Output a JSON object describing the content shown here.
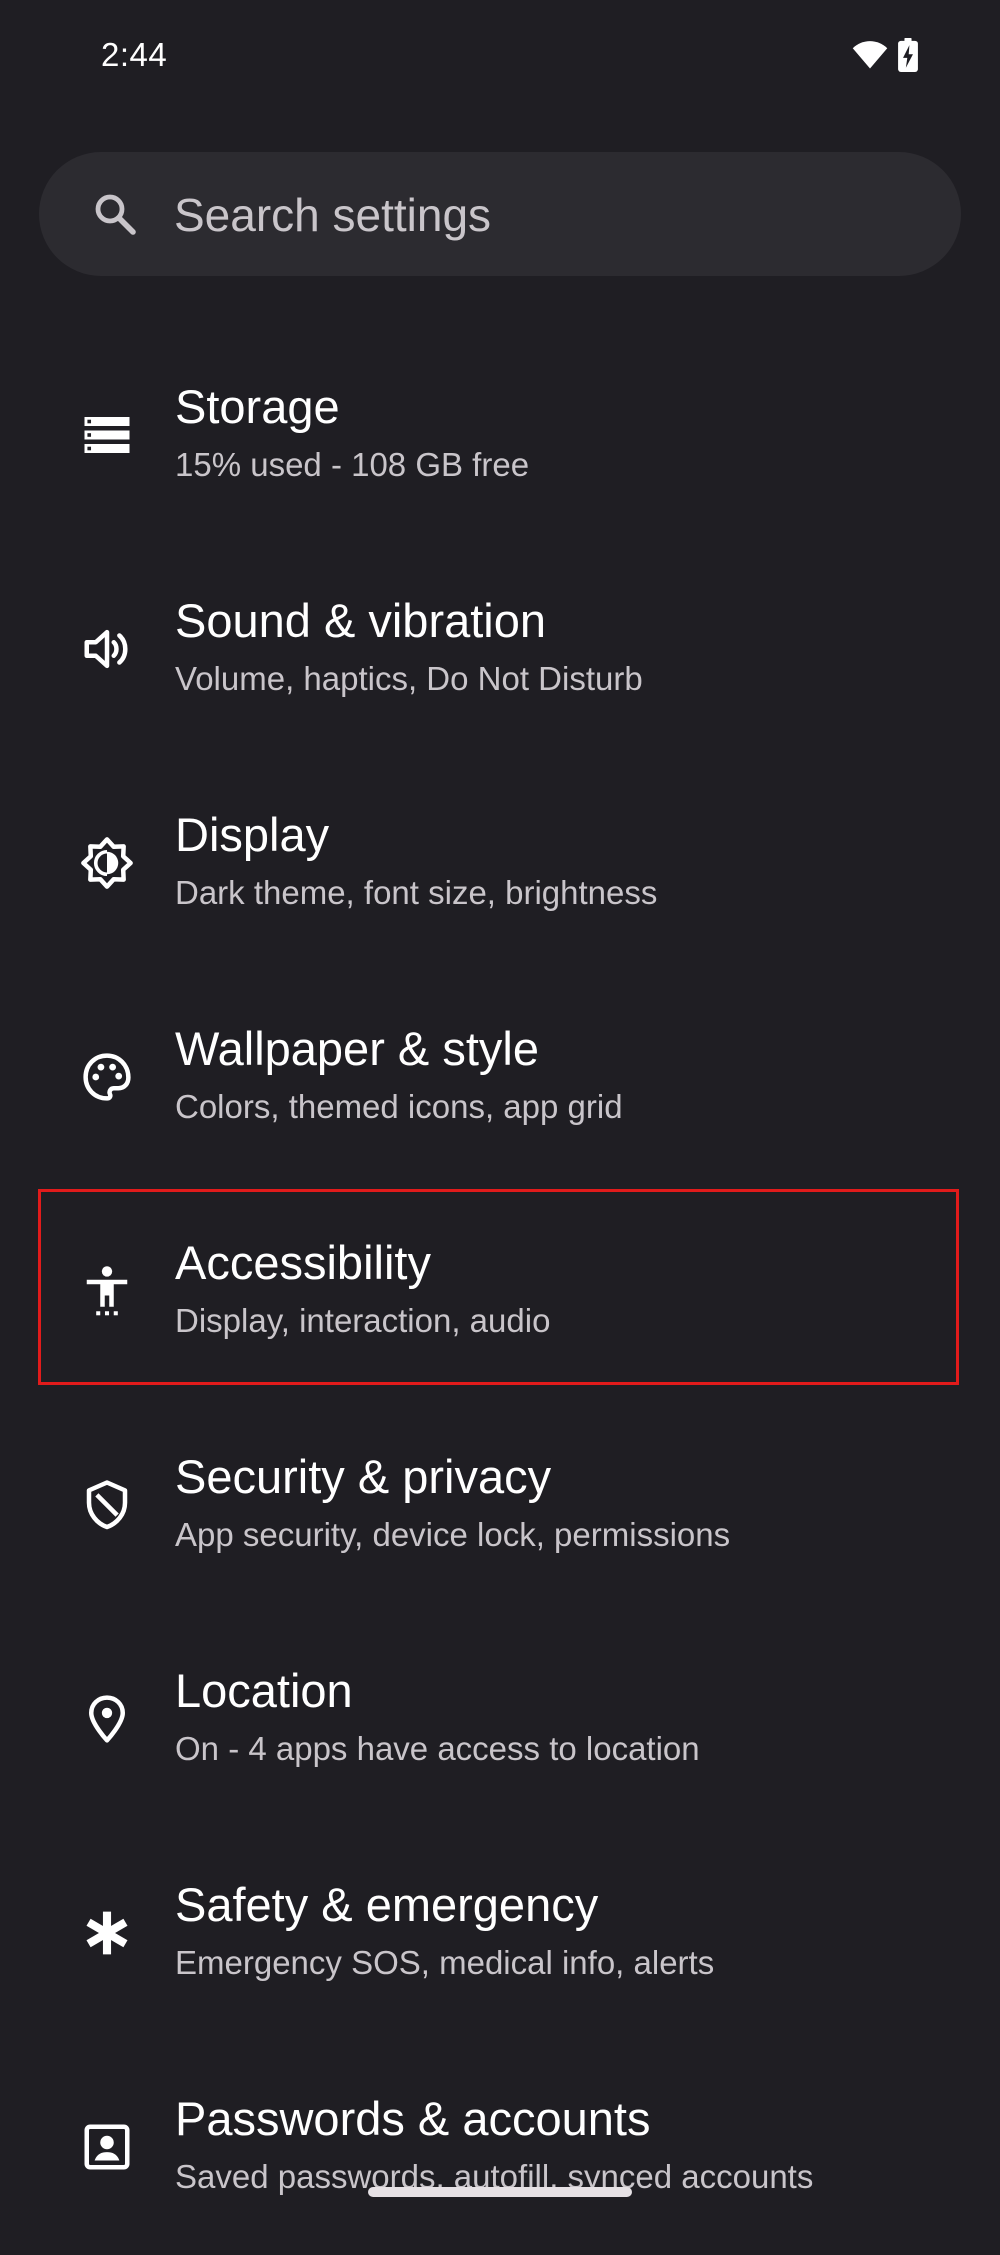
{
  "status_bar": {
    "time": "2:44"
  },
  "search": {
    "placeholder": "Search settings"
  },
  "items": [
    {
      "key": "storage",
      "icon": "storage-icon",
      "title": "Storage",
      "subtitle": "15% used - 108 GB free"
    },
    {
      "key": "sound",
      "icon": "speaker-icon",
      "title": "Sound & vibration",
      "subtitle": "Volume, haptics, Do Not Disturb"
    },
    {
      "key": "display",
      "icon": "brightness-icon",
      "title": "Display",
      "subtitle": "Dark theme, font size, brightness"
    },
    {
      "key": "wallpaper",
      "icon": "palette-icon",
      "title": "Wallpaper & style",
      "subtitle": "Colors, themed icons, app grid"
    },
    {
      "key": "accessibility",
      "icon": "accessibility-icon",
      "title": "Accessibility",
      "subtitle": "Display, interaction, audio"
    },
    {
      "key": "security",
      "icon": "shield-icon",
      "title": "Security & privacy",
      "subtitle": "App security, device lock, permissions"
    },
    {
      "key": "location",
      "icon": "location-pin-icon",
      "title": "Location",
      "subtitle": "On - 4 apps have access to location"
    },
    {
      "key": "safety",
      "icon": "asterisk-icon",
      "title": "Safety & emergency",
      "subtitle": "Emergency SOS, medical info, alerts"
    },
    {
      "key": "passwords",
      "icon": "account-box-icon",
      "title": "Passwords & accounts",
      "subtitle": "Saved passwords, autofill, synced accounts"
    }
  ],
  "colors": {
    "background": "#1f1e23",
    "search_bg": "#2c2b30",
    "highlight_border": "#e11b1b"
  }
}
